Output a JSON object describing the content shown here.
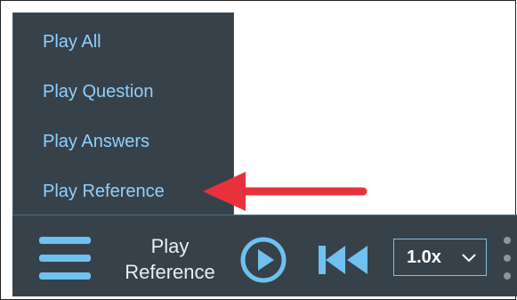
{
  "menu": {
    "items": [
      {
        "label": "Play All"
      },
      {
        "label": "Play Question"
      },
      {
        "label": "Play Answers"
      },
      {
        "label": "Play Reference"
      }
    ]
  },
  "toolbar": {
    "play_label_line1": "Play",
    "play_label_line2": "Reference",
    "speed_value": "1.0x"
  },
  "icons": {
    "menu": "hamburger-icon",
    "play": "play-icon",
    "rewind": "skip-back-icon",
    "dropdown": "chevron-down-icon",
    "more": "more-vertical-icon",
    "pointer": "red-arrow"
  },
  "colors": {
    "panel": "#37414a",
    "menu_text": "#8fd0ff",
    "icon_blue": "#6fc1ef",
    "arrow_red": "#e8323b"
  }
}
